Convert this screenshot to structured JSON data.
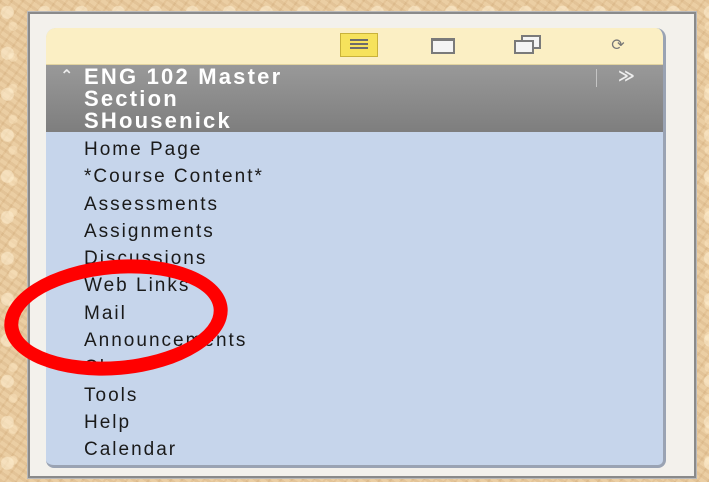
{
  "course": {
    "title": "ENG 102 Master\nSection\nSHousenick"
  },
  "toolbar": {
    "icons": [
      "list-view-icon",
      "folder-view-icon",
      "window-view-icon",
      "refresh-icon"
    ],
    "selected": "list-view-icon"
  },
  "header": {
    "collapse_icon": "⌃⌃",
    "expand_icon": "≫"
  },
  "menu": {
    "items": [
      {
        "label": "Home Page"
      },
      {
        "label": "*Course Content*"
      },
      {
        "label": "Assessments"
      },
      {
        "label": "Assignments"
      },
      {
        "label": "Discussions"
      },
      {
        "label": "Web Links"
      },
      {
        "label": "Mail"
      },
      {
        "label": "Announcements"
      },
      {
        "label": "Chat"
      },
      {
        "label": "Tools"
      },
      {
        "label": "Help"
      },
      {
        "label": "Calendar"
      }
    ]
  },
  "colors": {
    "annotation": "#ff0000",
    "menu_background": "#c6d5eb",
    "header_background": "#8c8c8c",
    "toolbar_background": "#fbefc4",
    "selected_icon": "#f6e25c"
  }
}
